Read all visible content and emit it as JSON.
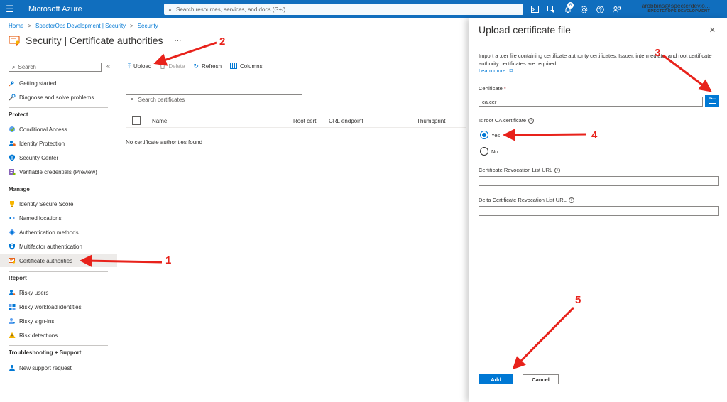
{
  "topbar": {
    "brand": "Microsoft Azure",
    "search_placeholder": "Search resources, services, and docs (G+/)",
    "notification_count": "6",
    "account_email": "arobbins@specterdev.o...",
    "account_tenant": "SPECTEROPS DEVELOPMENT"
  },
  "breadcrumb": [
    "Home",
    "SpecterOps Development | Security",
    "Security"
  ],
  "page_title": "Security | Certificate authorities",
  "title_more": "···",
  "nav": {
    "search_placeholder": "Search",
    "collapse": "«",
    "top_items": [
      "Getting started",
      "Diagnose and solve problems"
    ],
    "sections": [
      {
        "title": "Protect",
        "items": [
          "Conditional Access",
          "Identity Protection",
          "Security Center",
          "Verifiable credentials (Preview)"
        ]
      },
      {
        "title": "Manage",
        "items": [
          "Identity Secure Score",
          "Named locations",
          "Authentication methods",
          "Multifactor authentication",
          "Certificate authorities"
        ]
      },
      {
        "title": "Report",
        "items": [
          "Risky users",
          "Risky workload identities",
          "Risky sign-ins",
          "Risk detections"
        ]
      },
      {
        "title": "Troubleshooting + Support",
        "items": [
          "New support request"
        ]
      }
    ],
    "selected": "Certificate authorities"
  },
  "commands": {
    "upload": "Upload",
    "delete": "Delete",
    "refresh": "Refresh",
    "columns": "Columns"
  },
  "cert_search_placeholder": "Search certificates",
  "table": {
    "columns": [
      "Name",
      "Root cert",
      "CRL endpoint",
      "Thumbprint"
    ],
    "empty_message": "No certificate authorities found"
  },
  "blade": {
    "title": "Upload certificate file",
    "close": "✕",
    "description": "Import a .cer file containing certificate authority certificates. Issuer, intermediate, and root certificate authority certificates are required.",
    "learn_more": "Learn more",
    "certificate_label": "Certificate",
    "certificate_required": "*",
    "certificate_value": "ca.cer",
    "is_root_label": "Is root CA certificate",
    "yes_label": "Yes",
    "no_label": "No",
    "root_selected": "Yes",
    "crl_label": "Certificate Revocation List URL",
    "crl_value": "",
    "delta_crl_label": "Delta Certificate Revocation List URL",
    "delta_crl_value": "",
    "add_button": "Add",
    "cancel_button": "Cancel"
  },
  "annotations": [
    "1",
    "2",
    "3",
    "4",
    "5"
  ],
  "colors": {
    "azure_blue": "#106ebe",
    "primary": "#0078d4",
    "annotation_red": "#e8221b"
  }
}
